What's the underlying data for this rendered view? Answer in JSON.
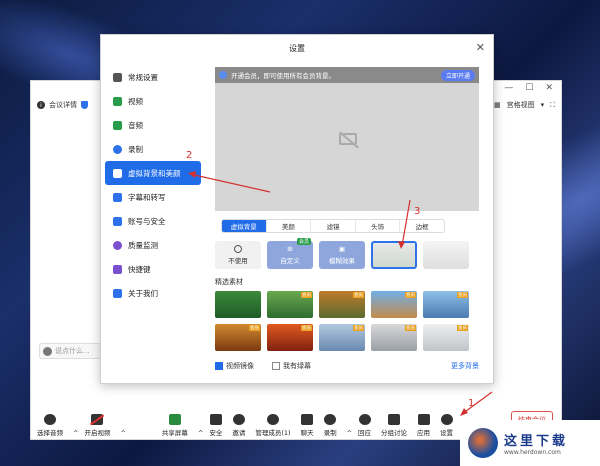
{
  "meeting": {
    "topbar": {
      "info": "会议详情",
      "view": "宫格视图"
    },
    "chat_placeholder": "说点什么...",
    "toolbar": [
      {
        "id": "audio",
        "label": "选择音频"
      },
      {
        "id": "video",
        "label": "开启视频"
      },
      {
        "id": "share",
        "label": "共享屏幕"
      },
      {
        "id": "security",
        "label": "安全"
      },
      {
        "id": "invite",
        "label": "邀请"
      },
      {
        "id": "members",
        "label": "管理成员(1)"
      },
      {
        "id": "chat",
        "label": "聊天"
      },
      {
        "id": "record",
        "label": "录制"
      },
      {
        "id": "react",
        "label": "回应"
      },
      {
        "id": "breakout",
        "label": "分组讨论"
      },
      {
        "id": "apps",
        "label": "应用"
      },
      {
        "id": "settings",
        "label": "设置"
      }
    ],
    "end_button": "结束会议"
  },
  "settings": {
    "title": "设置",
    "sidebar": [
      {
        "label": "常规设置",
        "color": "#555555"
      },
      {
        "label": "视频",
        "color": "#2a9d4a"
      },
      {
        "label": "音频",
        "color": "#2a9d4a"
      },
      {
        "label": "录制",
        "color": "#2d72e8"
      },
      {
        "label": "虚拟背景和美颜",
        "color": "#ffffff"
      },
      {
        "label": "字幕和转写",
        "color": "#2d72e8"
      },
      {
        "label": "账号与安全",
        "color": "#2d72e8"
      },
      {
        "label": "质量监测",
        "color": "#7a4fd0"
      },
      {
        "label": "快捷键",
        "color": "#7a4fd0"
      },
      {
        "label": "关于我们",
        "color": "#2d72e8"
      }
    ],
    "banner_text": "开通会员，即可使用所有会员背景。",
    "banner_button": "立即开通",
    "tabs": [
      "虚拟背景",
      "美颜",
      "滤镜",
      "头饰",
      "边框"
    ],
    "bg_options": [
      {
        "label": "不使用",
        "badge": ""
      },
      {
        "label": "自定义",
        "badge": "会员"
      },
      {
        "label": "模糊效果",
        "badge": ""
      },
      {
        "label": "",
        "badge": ""
      },
      {
        "label": "",
        "badge": ""
      }
    ],
    "section_title": "精选素材",
    "mirror_label": "视频镜像",
    "greenscreen_label": "我有绿幕",
    "more_label": "更多背景",
    "thumb_tag": "会员"
  },
  "annotations": [
    "1",
    "2",
    "3"
  ],
  "watermark": {
    "name": "这里下载",
    "url": "www.herdown.com"
  }
}
